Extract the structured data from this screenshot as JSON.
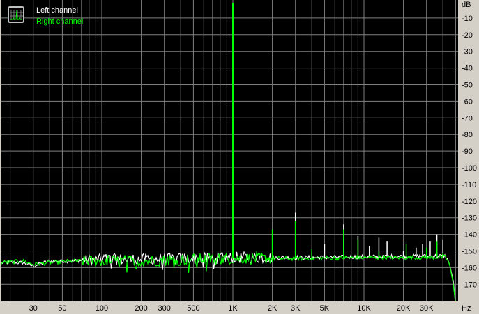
{
  "chart_data": {
    "type": "line",
    "title": "",
    "xlabel": "Hz",
    "ylabel": "dB",
    "x_scale": "log",
    "xlim": [
      17,
      52000
    ],
    "ylim": [
      -180,
      0
    ],
    "grid": true,
    "background": "#000000",
    "grid_color": "#808080",
    "legend_placement": "top-left",
    "x_ticks": [
      {
        "value": 30,
        "label": "30"
      },
      {
        "value": 50,
        "label": "50"
      },
      {
        "value": 100,
        "label": "100"
      },
      {
        "value": 200,
        "label": "200"
      },
      {
        "value": 300,
        "label": "300"
      },
      {
        "value": 500,
        "label": "500"
      },
      {
        "value": 1000,
        "label": "1K"
      },
      {
        "value": 2000,
        "label": "2K"
      },
      {
        "value": 3000,
        "label": "3K"
      },
      {
        "value": 5000,
        "label": "5K"
      },
      {
        "value": 10000,
        "label": "10K"
      },
      {
        "value": 20000,
        "label": "20K"
      },
      {
        "value": 30000,
        "label": "30K"
      }
    ],
    "y_ticks": [
      {
        "value": -10,
        "label": "-10"
      },
      {
        "value": -20,
        "label": "-20"
      },
      {
        "value": -30,
        "label": "-30"
      },
      {
        "value": -40,
        "label": "-40"
      },
      {
        "value": -50,
        "label": "-50"
      },
      {
        "value": -60,
        "label": "-60"
      },
      {
        "value": -70,
        "label": "-70"
      },
      {
        "value": -80,
        "label": "-80"
      },
      {
        "value": -90,
        "label": "-90"
      },
      {
        "value": -100,
        "label": "-100"
      },
      {
        "value": -110,
        "label": "-110"
      },
      {
        "value": -120,
        "label": "-120"
      },
      {
        "value": -130,
        "label": "-130"
      },
      {
        "value": -140,
        "label": "-140"
      },
      {
        "value": -150,
        "label": "-150"
      },
      {
        "value": -160,
        "label": "-160"
      },
      {
        "value": -170,
        "label": "-170"
      }
    ],
    "series": [
      {
        "name": "Left channel",
        "color": "#ffffff",
        "noise_floor": [
          [
            17,
            -157
          ],
          [
            25,
            -157
          ],
          [
            30,
            -159
          ],
          [
            40,
            -156
          ],
          [
            60,
            -156
          ],
          [
            100,
            -155
          ],
          [
            200,
            -155
          ],
          [
            500,
            -154.5
          ],
          [
            1000,
            -154
          ],
          [
            3000,
            -154
          ],
          [
            10000,
            -153.5
          ],
          [
            30000,
            -153
          ],
          [
            42000,
            -153
          ],
          [
            45000,
            -158
          ],
          [
            48000,
            -168
          ],
          [
            50000,
            -182
          ]
        ],
        "spikes": [
          [
            1000,
            -138
          ],
          [
            3000,
            -127
          ],
          [
            4000,
            -150
          ],
          [
            5000,
            -146
          ],
          [
            7000,
            -134
          ],
          [
            9000,
            -141
          ],
          [
            11000,
            -147
          ],
          [
            13000,
            -142
          ],
          [
            15000,
            -144
          ],
          [
            20000,
            -150
          ],
          [
            25000,
            -148
          ],
          [
            28000,
            -146
          ],
          [
            32000,
            -144
          ],
          [
            36000,
            -140
          ],
          [
            40000,
            -143
          ]
        ]
      },
      {
        "name": "Right channel",
        "color": "#00ff00",
        "noise_floor": [
          [
            17,
            -157
          ],
          [
            25,
            -156
          ],
          [
            30,
            -158
          ],
          [
            40,
            -157
          ],
          [
            60,
            -156
          ],
          [
            100,
            -156
          ],
          [
            200,
            -156
          ],
          [
            500,
            -155
          ],
          [
            1000,
            -154.5
          ],
          [
            3000,
            -154.5
          ],
          [
            10000,
            -154
          ],
          [
            30000,
            -154
          ],
          [
            42000,
            -153.5
          ],
          [
            45000,
            -158
          ],
          [
            48000,
            -170
          ],
          [
            50000,
            -182
          ]
        ],
        "spikes": [
          [
            1000,
            -1
          ],
          [
            2000,
            -137
          ],
          [
            3000,
            -132
          ],
          [
            4000,
            -149
          ],
          [
            7000,
            -137
          ],
          [
            9000,
            -143
          ],
          [
            13000,
            -150
          ],
          [
            21000,
            -146
          ],
          [
            30000,
            -148
          ],
          [
            36000,
            -144
          ],
          [
            40000,
            -151
          ]
        ]
      }
    ]
  }
}
